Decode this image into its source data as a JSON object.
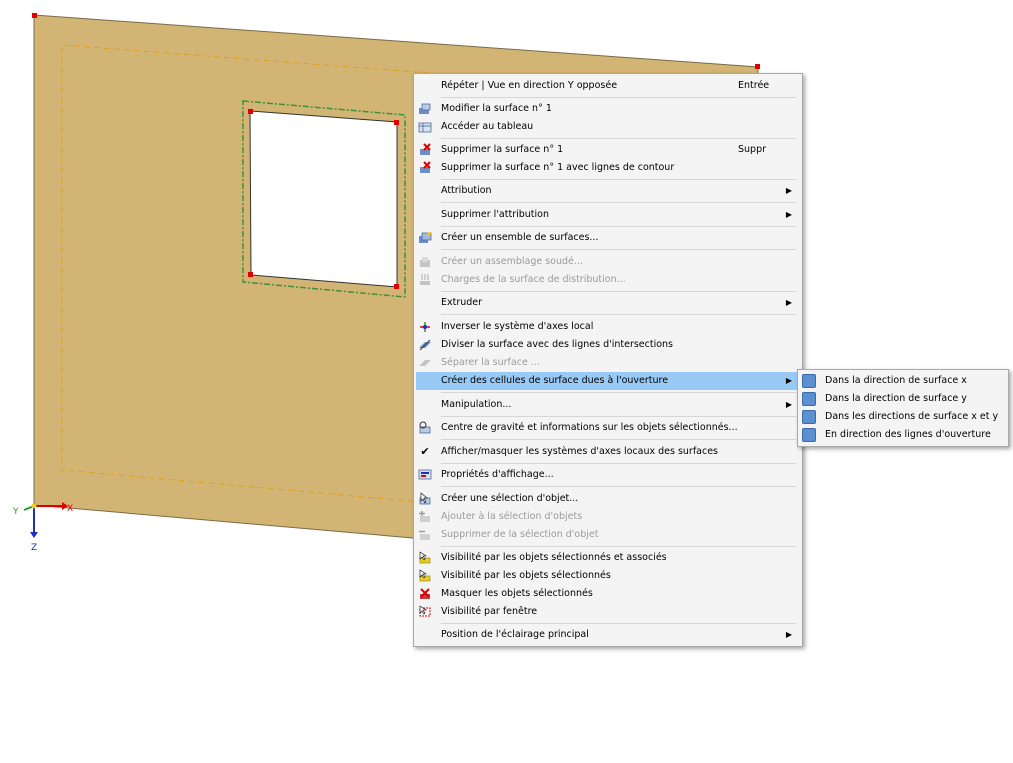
{
  "axes": {
    "y": "Y",
    "x": "X",
    "z": "Z"
  },
  "colors": {
    "surface": "#d2b574",
    "opening_border": "#3f8f3f",
    "node": "#e00000",
    "menu_bg": "#f4f4f4",
    "highlight": "#99c9f5"
  },
  "context_menu": {
    "items": [
      {
        "label": "Répéter | Vue en direction Y opposée",
        "shortcut": "Entrée"
      },
      {
        "label": "Modifier la surface n° 1",
        "icon": "edit-surface-icon"
      },
      {
        "label": "Accéder au tableau",
        "icon": "table-icon"
      },
      {
        "label": "Supprimer la surface n° 1",
        "shortcut": "Suppr",
        "icon": "delete-surface-icon"
      },
      {
        "label": "Supprimer la surface n° 1 avec lignes de contour",
        "icon": "delete-surface-lines-icon"
      },
      {
        "label": "Attribution",
        "submenu": true
      },
      {
        "label": "Supprimer l'attribution",
        "submenu": true
      },
      {
        "label": "Créer un ensemble de surfaces...",
        "icon": "surface-set-icon"
      },
      {
        "label": "Créer un assemblage soudé...",
        "disabled": true,
        "icon": "welded-assembly-icon"
      },
      {
        "label": "Charges de la surface de distribution...",
        "disabled": true,
        "icon": "load-distribution-icon"
      },
      {
        "label": "Extruder",
        "submenu": true
      },
      {
        "label": "Inverser le système d'axes local",
        "icon": "invert-axes-icon"
      },
      {
        "label": "Diviser la surface avec des lignes d'intersections",
        "icon": "divide-surface-icon"
      },
      {
        "label": "Séparer la surface ...",
        "disabled": true,
        "icon": "separate-surface-icon"
      },
      {
        "label": "Créer des cellules de surface dues à l'ouverture",
        "submenu": true,
        "highlighted": true
      },
      {
        "label": "Manipulation...",
        "submenu": true
      },
      {
        "label": "Centre de gravité et informations sur les objets sélectionnés...",
        "icon": "center-gravity-icon"
      },
      {
        "label": "Afficher/masquer les systèmes d'axes locaux des surfaces",
        "checked": true,
        "icon": "check-icon"
      },
      {
        "label": "Propriétés d'affichage...",
        "icon": "display-properties-icon"
      },
      {
        "label": "Créer une sélection d'objet...",
        "icon": "create-selection-icon"
      },
      {
        "label": "Ajouter à la sélection d'objets",
        "disabled": true,
        "icon": "add-selection-icon"
      },
      {
        "label": "Supprimer de la sélection d'objet",
        "disabled": true,
        "icon": "remove-selection-icon"
      },
      {
        "label": "Visibilité par les objets sélectionnés et associés",
        "icon": "visibility-associated-icon"
      },
      {
        "label": "Visibilité par les objets sélectionnés",
        "icon": "visibility-selected-icon"
      },
      {
        "label": "Masquer les objets sélectionnés",
        "icon": "hide-selected-icon"
      },
      {
        "label": "Visibilité par fenêtre",
        "icon": "visibility-window-icon"
      },
      {
        "label": "Position de l'éclairage principal",
        "submenu": true
      }
    ]
  },
  "submenu": {
    "items": [
      {
        "label": "Dans la direction de surface x",
        "icon": "surface-cell-icon"
      },
      {
        "label": "Dans la direction de surface y",
        "icon": "surface-cell-icon"
      },
      {
        "label": "Dans les directions de surface x et y",
        "icon": "surface-cell-icon"
      },
      {
        "label": "En direction des lignes d'ouverture",
        "icon": "surface-cell-icon"
      }
    ]
  }
}
